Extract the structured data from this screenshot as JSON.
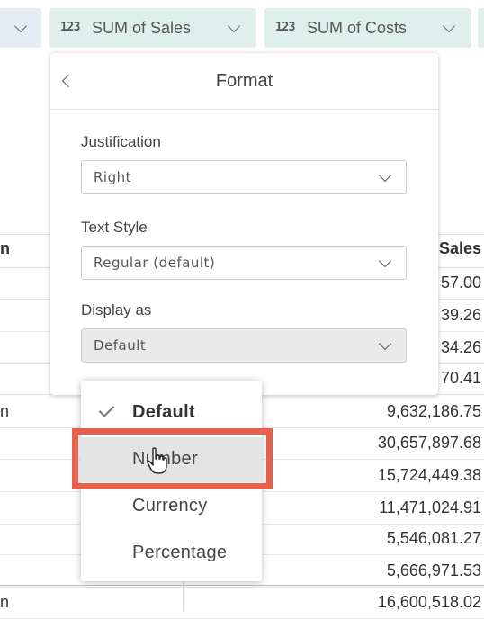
{
  "pills": {
    "sales": {
      "num_icon": "123",
      "label": "SUM of Sales"
    },
    "costs": {
      "num_icon": "123",
      "label": "SUM of Costs"
    }
  },
  "table": {
    "header_left": "n",
    "header_right": "Sales",
    "rows": [
      {
        "left": "",
        "value": "57.00"
      },
      {
        "left": "",
        "value": "39.26"
      },
      {
        "left": "",
        "value": "34.26"
      },
      {
        "left": "",
        "value": "70.41"
      },
      {
        "left": "n",
        "value": "9,632,186.75"
      },
      {
        "left": "",
        "value": "30,657,897.68"
      },
      {
        "left": "",
        "value": "15,724,449.38"
      },
      {
        "left": "",
        "value": "11,471,024.91"
      },
      {
        "left": "",
        "value": "5,546,081.27"
      },
      {
        "left": "",
        "value": "5,666,971.53"
      },
      {
        "left": "n",
        "value": "16,600,518.02"
      }
    ]
  },
  "format_panel": {
    "title": "Format",
    "justification": {
      "label": "Justification",
      "value": "Right"
    },
    "text_style": {
      "label": "Text Style",
      "value": "Regular (default)"
    },
    "display_as": {
      "label": "Display as",
      "value": "Default"
    }
  },
  "display_menu": {
    "options": [
      "Default",
      "Number",
      "Currency",
      "Percentage"
    ],
    "selected": "Default",
    "hovered": "Number"
  },
  "colors": {
    "pill_bg": "#dff0ec",
    "highlight_box": "#e8604c",
    "hover_bg": "#e4e4e4"
  }
}
